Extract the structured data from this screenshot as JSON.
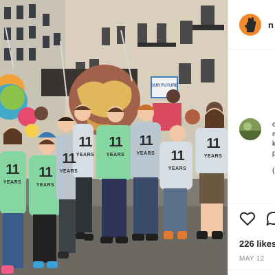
{
  "post": {
    "username": "n",
    "sign_text": "OUR FUTURE",
    "shirt": {
      "number": "11",
      "label": "YEARS"
    }
  },
  "comments": {
    "fragments": [
      "c",
      "m",
      "k",
      "p",
      "("
    ]
  },
  "engagement": {
    "likes": "226 likes",
    "date": "MAY 12"
  },
  "icons": {
    "avatar": "raised-hand-logo-icon",
    "like": "heart-icon",
    "comment": "comment-bubble-icon"
  },
  "colors": {
    "avatar_bg": "#f08a2c",
    "shirt_green": "#86d6a2",
    "shirt_grey": "#b9c6cf",
    "text_primary": "#262626",
    "text_secondary": "#8e8e8e"
  }
}
